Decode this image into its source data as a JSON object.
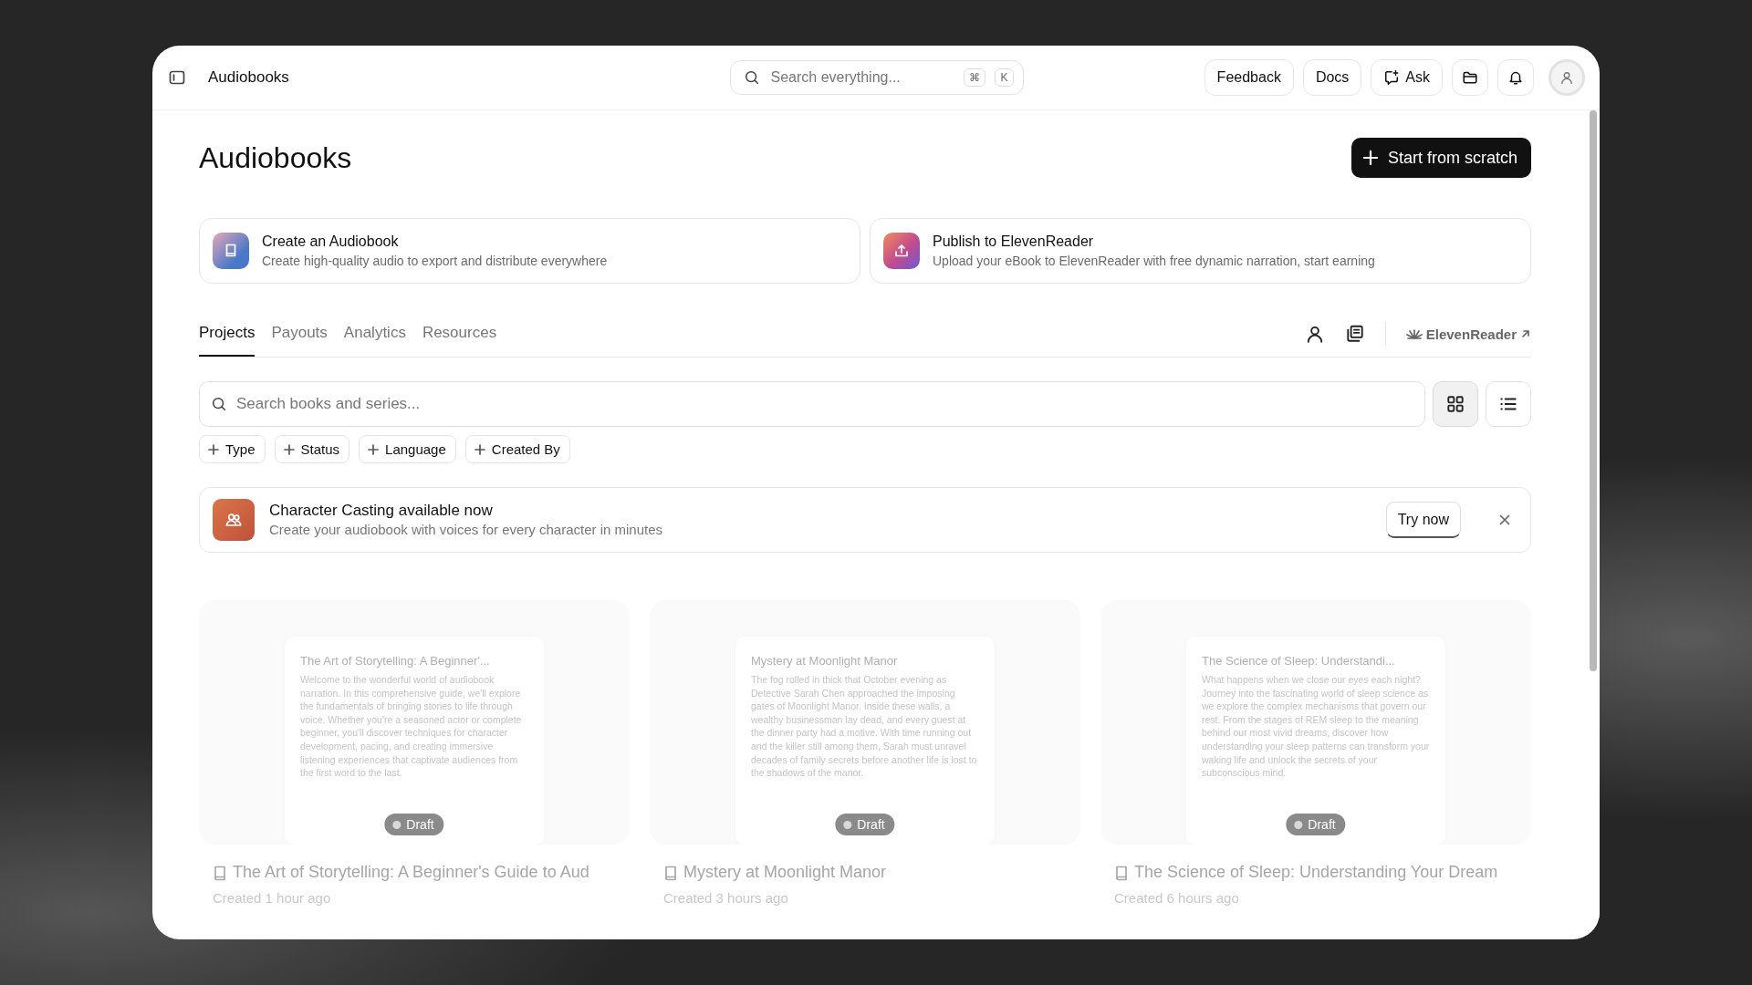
{
  "window": {
    "title": "Audiobooks"
  },
  "top_bar": {
    "search": {
      "placeholder": "Search everything...",
      "shortcut_keys": [
        "⌘",
        "K"
      ]
    },
    "buttons": [
      {
        "kind": "text",
        "label": "Feedback"
      },
      {
        "kind": "text",
        "label": "Docs"
      },
      {
        "kind": "ask",
        "label": "Ask"
      },
      {
        "kind": "folder"
      },
      {
        "kind": "bell"
      },
      {
        "kind": "avatar"
      }
    ]
  },
  "page": {
    "title": "Audiobooks",
    "primary_button": {
      "label": "Start from scratch"
    }
  },
  "feature_cards": [
    {
      "kind": "create",
      "title": "Create an Audiobook",
      "description": "Create high-quality audio to export and distribute everywhere"
    },
    {
      "kind": "publish",
      "title": "Publish to ElevenReader",
      "description": "Upload your eBook to ElevenReader with free dynamic narration, start earning"
    }
  ],
  "tabs": [
    {
      "label": "Projects",
      "selected": true
    },
    {
      "label": "Payouts",
      "selected": false
    },
    {
      "label": "Analytics",
      "selected": false
    },
    {
      "label": "Resources",
      "selected": false
    }
  ],
  "tab_tools": {
    "link": "ElevenReader"
  },
  "search": {
    "placeholder": "Search books and series..."
  },
  "view_toggle": [
    {
      "kind": "grid",
      "selected": true
    },
    {
      "kind": "list",
      "selected": false
    }
  ],
  "filters": [
    "Type",
    "Status",
    "Language",
    "Created By"
  ],
  "banner": {
    "title": "Character Casting available now",
    "description": "Create your audiobook with voices for every character in minutes",
    "action": "Try now"
  },
  "books": [
    {
      "preview_title": "The Art of Storytelling: A Beginner'...",
      "preview_text": "Welcome to the wonderful world of audiobook narration. In this comprehensive guide, we'll explore the fundamentals of bringing stories to life through voice. Whether you're a seasoned actor or complete beginner, you'll discover techniques for character development, pacing, and creating immersive listening experiences that captivate audiences from the first word to the last.",
      "status": "Draft",
      "title": "The Art of Storytelling: A Beginner's Guide to Aud",
      "created": "Created 1 hour ago"
    },
    {
      "preview_title": "Mystery at Moonlight Manor",
      "preview_text": "The fog rolled in thick that October evening as Detective Sarah Chen approached the imposing gates of Moonlight Manor. Inside these walls, a wealthy businessman lay dead, and every guest at the dinner party had a motive. With time running out and the killer still among them, Sarah must unravel decades of family secrets before another life is lost to the shadows of the manor.",
      "status": "Draft",
      "title": "Mystery at Moonlight Manor",
      "created": "Created 3 hours ago"
    },
    {
      "preview_title": "The Science of Sleep: Understandi...",
      "preview_text": "What happens when we close our eyes each night? Journey into the fascinating world of sleep science as we explore the complex mechanisms that govern our rest. From the stages of REM sleep to the meaning behind our most vivid dreams, discover how understanding your sleep patterns can transform your waking life and unlock the secrets of your subconscious mind.",
      "status": "Draft",
      "title": "The Science of Sleep: Understanding Your Dream",
      "created": "Created 6 hours ago"
    }
  ]
}
